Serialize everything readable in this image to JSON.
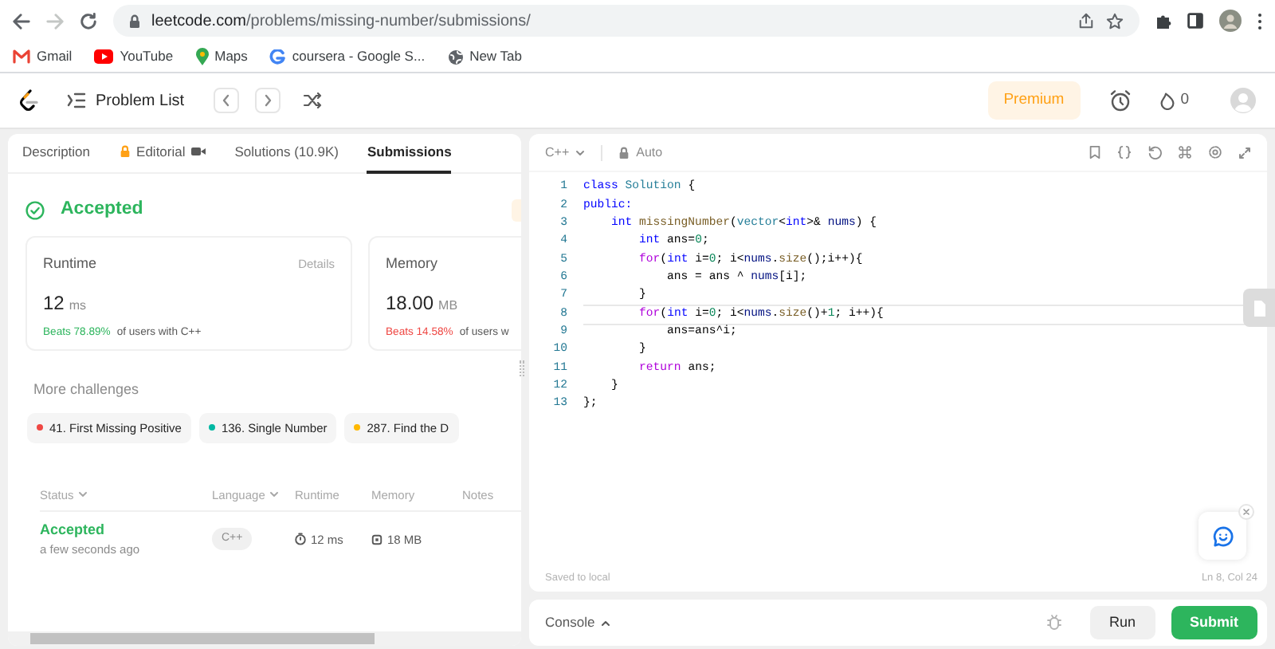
{
  "browser": {
    "url_host": "leetcode.com",
    "url_path": "/problems/missing-number/submissions/",
    "bookmarks": [
      {
        "label": "Gmail",
        "kind": "mail"
      },
      {
        "label": "YouTube",
        "kind": "video"
      },
      {
        "label": "Maps",
        "kind": "pin"
      },
      {
        "label": "coursera - Google S...",
        "kind": "google"
      },
      {
        "label": "New Tab",
        "kind": "globe"
      }
    ]
  },
  "navbar": {
    "title": "Problem List",
    "premium": "Premium",
    "streak": "0"
  },
  "left_panel": {
    "tabs": [
      {
        "label": "Description",
        "selected": false,
        "kind": "plain"
      },
      {
        "label": "Editorial",
        "selected": false,
        "kind": "locked"
      },
      {
        "label": "Solutions (10.9K)",
        "selected": false,
        "kind": "plain"
      },
      {
        "label": "Submissions",
        "selected": true,
        "kind": "plain"
      }
    ],
    "result": "Accepted",
    "stats": [
      {
        "title": "Runtime",
        "link": "Details",
        "value": "12",
        "unit": "ms",
        "beats": "Beats 78.89%",
        "beats_rest": "of users with C++",
        "color": "#2db55d"
      },
      {
        "title": "Memory",
        "value": "18.00",
        "unit": "MB",
        "beats": "Beats 14.58%",
        "beats_rest": "of users w",
        "color": "#ef4743"
      }
    ],
    "more_title": "More challenges",
    "challenges": [
      {
        "label": "41. First Missing Positive",
        "color": "#ef4743"
      },
      {
        "label": "136. Single Number",
        "color": "#00b8a3"
      },
      {
        "label": "287. Find the D",
        "color": "#ffb800"
      }
    ],
    "table": {
      "columns": [
        {
          "label": "Status",
          "sortable": true
        },
        {
          "label": "Language",
          "sortable": true
        },
        {
          "label": "Runtime",
          "sortable": false
        },
        {
          "label": "Memory",
          "sortable": false
        },
        {
          "label": "Notes",
          "sortable": false
        }
      ],
      "rows": [
        {
          "status": "Accepted",
          "time": "a few seconds ago",
          "language": "C++",
          "runtime": "12 ms",
          "memory": "18 MB"
        }
      ]
    }
  },
  "editor": {
    "language": "C++",
    "mode": "Auto",
    "lines": [
      {
        "number": "1",
        "current": false,
        "tokens": [
          {
            "text": "class ",
            "kind": "keyword"
          },
          {
            "text": "Solution",
            "kind": "type"
          },
          {
            "text": " {",
            "kind": "plain"
          }
        ]
      },
      {
        "number": "2",
        "current": false,
        "tokens": [
          {
            "text": "public:",
            "kind": "keyword"
          }
        ]
      },
      {
        "number": "3",
        "current": false,
        "tokens": [
          {
            "text": "    int ",
            "kind": "keyword"
          },
          {
            "text": "missingNumber",
            "kind": "func"
          },
          {
            "text": "(",
            "kind": "plain"
          },
          {
            "text": "vector",
            "kind": "type"
          },
          {
            "text": "<",
            "kind": "plain"
          },
          {
            "text": "int",
            "kind": "keyword"
          },
          {
            "text": ">& ",
            "kind": "plain"
          },
          {
            "text": "nums",
            "kind": "var"
          },
          {
            "text": ") {",
            "kind": "plain"
          }
        ]
      },
      {
        "number": "4",
        "current": false,
        "tokens": [
          {
            "text": "        int",
            "kind": "keyword"
          },
          {
            "text": " ans=",
            "kind": "plain"
          },
          {
            "text": "0",
            "kind": "number"
          },
          {
            "text": ";",
            "kind": "plain"
          }
        ]
      },
      {
        "number": "5",
        "current": false,
        "tokens": [
          {
            "text": "        for",
            "kind": "control"
          },
          {
            "text": "(",
            "kind": "plain"
          },
          {
            "text": "int",
            "kind": "keyword"
          },
          {
            "text": " i=",
            "kind": "plain"
          },
          {
            "text": "0",
            "kind": "number"
          },
          {
            "text": "; i<",
            "kind": "plain"
          },
          {
            "text": "nums",
            "kind": "var"
          },
          {
            "text": ".",
            "kind": "plain"
          },
          {
            "text": "size",
            "kind": "func"
          },
          {
            "text": "();i++){",
            "kind": "plain"
          }
        ]
      },
      {
        "number": "6",
        "current": false,
        "tokens": [
          {
            "text": "            ans = ans ^ ",
            "kind": "plain"
          },
          {
            "text": "nums",
            "kind": "var"
          },
          {
            "text": "[i];",
            "kind": "plain"
          }
        ]
      },
      {
        "number": "7",
        "current": false,
        "tokens": [
          {
            "text": "        }",
            "kind": "plain"
          }
        ]
      },
      {
        "number": "8",
        "current": true,
        "tokens": [
          {
            "text": "        for",
            "kind": "control"
          },
          {
            "text": "(",
            "kind": "plain"
          },
          {
            "text": "int",
            "kind": "keyword"
          },
          {
            "text": " i=",
            "kind": "plain"
          },
          {
            "text": "0",
            "kind": "number"
          },
          {
            "text": "; i<",
            "kind": "plain"
          },
          {
            "text": "nums",
            "kind": "var"
          },
          {
            "text": ".",
            "kind": "plain"
          },
          {
            "text": "size",
            "kind": "func"
          },
          {
            "text": "()+",
            "kind": "plain"
          },
          {
            "text": "1",
            "kind": "number"
          },
          {
            "text": "; i++){",
            "kind": "plain"
          }
        ]
      },
      {
        "number": "9",
        "current": false,
        "tokens": [
          {
            "text": "            ans=ans^i;",
            "kind": "plain"
          }
        ]
      },
      {
        "number": "10",
        "current": false,
        "tokens": [
          {
            "text": "        }",
            "kind": "plain"
          }
        ]
      },
      {
        "number": "11",
        "current": false,
        "tokens": [
          {
            "text": "        return",
            "kind": "control"
          },
          {
            "text": " ans;",
            "kind": "plain"
          }
        ]
      },
      {
        "number": "12",
        "current": false,
        "tokens": [
          {
            "text": "    }",
            "kind": "plain"
          }
        ]
      },
      {
        "number": "13",
        "current": false,
        "tokens": [
          {
            "text": "};",
            "kind": "plain"
          }
        ]
      }
    ],
    "saved": "Saved to local",
    "cursor": "Ln 8, Col 24"
  },
  "console": {
    "label": "Console",
    "run": "Run",
    "submit": "Submit"
  }
}
